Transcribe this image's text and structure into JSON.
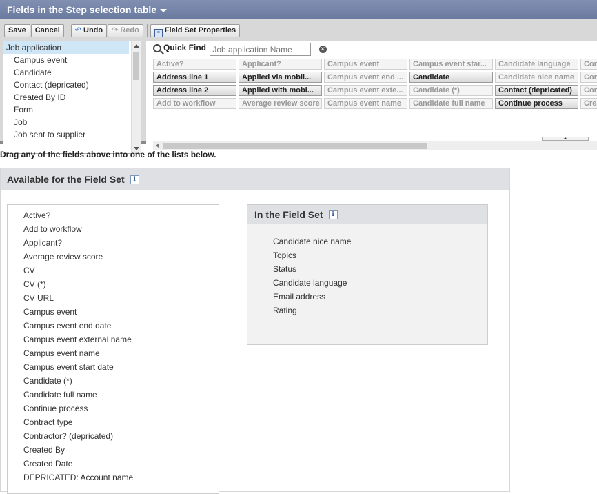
{
  "header": {
    "title": "Fields in the Step selection table"
  },
  "toolbar": {
    "save": "Save",
    "cancel": "Cancel",
    "undo": "Undo",
    "redo": "Redo",
    "field_set_properties": "Field Set Properties"
  },
  "object_list": {
    "items": [
      "Job application",
      "Campus event",
      "Candidate",
      "Contact (depricated)",
      "Created By ID",
      "Form",
      "Job",
      "Job sent to supplier"
    ],
    "selected": "Job application"
  },
  "quick_find": {
    "label": "Quick Find",
    "placeholder": "Job application Name"
  },
  "palette": {
    "rows": [
      [
        "Active?",
        "Applicant?",
        "Campus event",
        "Campus event star...",
        "Candidate language",
        "Con"
      ],
      [
        "Address line 1",
        "Applied via mobil...",
        "Campus event end ...",
        "Candidate",
        "Candidate nice name",
        "Con"
      ],
      [
        "Address line 2",
        "Applied with mobi...",
        "Campus event exte...",
        "Candidate (*)",
        "Contact (depricated)",
        "Con"
      ],
      [
        "Add to workflow",
        "Average review score",
        "Campus event name",
        "Candidate full name",
        "Continue process",
        "Crea"
      ]
    ]
  },
  "instructions": "Drag any of the fields above into one of the lists below.",
  "available": {
    "title": "Available for the Field Set",
    "fields": [
      "Active?",
      "Add to workflow",
      "Applicant?",
      "Average review score",
      "CV",
      "CV (*)",
      "CV URL",
      "Campus event",
      "Campus event end date",
      "Campus event external name",
      "Campus event name",
      "Campus event start date",
      "Candidate (*)",
      "Candidate full name",
      "Continue process",
      "Contract type",
      "Contractor? (depricated)",
      "Created By",
      "Created Date",
      "DEPRICATED: Account name"
    ]
  },
  "in_field_set": {
    "title": "In the Field Set",
    "fields": [
      "Candidate nice name",
      "Topics",
      "Status",
      "Candidate language",
      "Email address",
      "Rating"
    ]
  }
}
